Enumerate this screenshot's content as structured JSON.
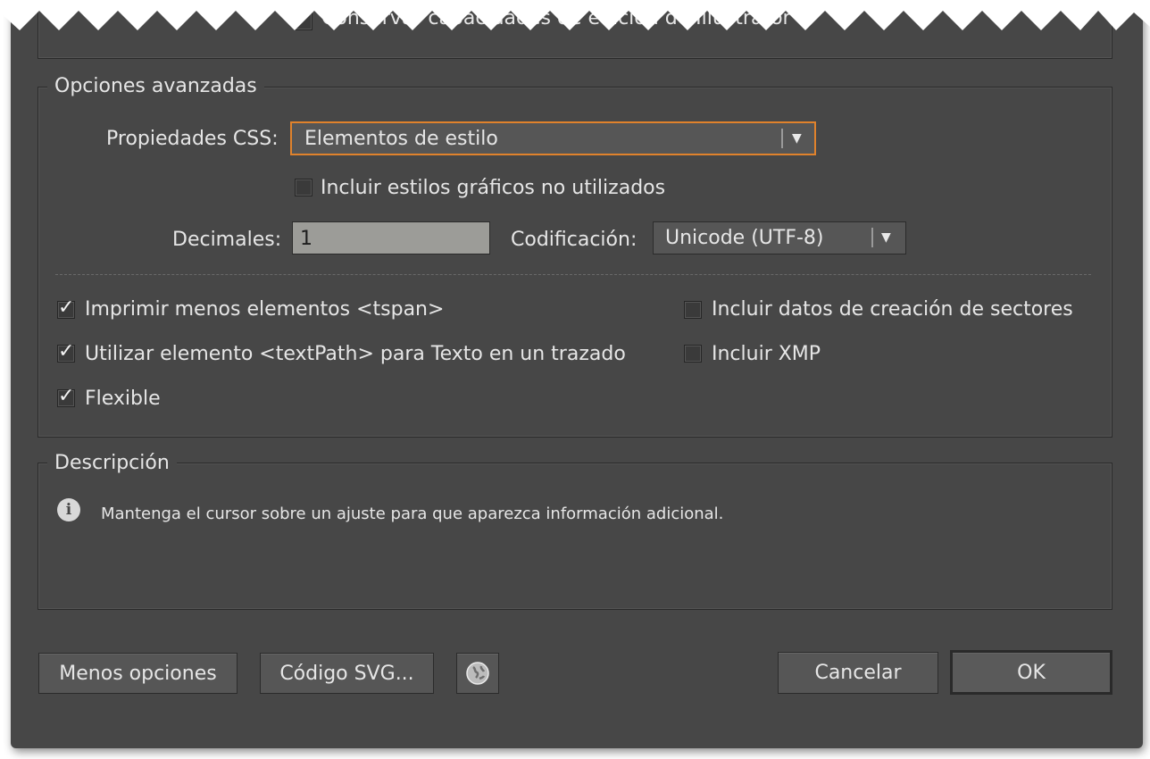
{
  "top_partial_option": "Conservar capacidades de edición de Illustrator",
  "advanced": {
    "legend": "Opciones avanzadas",
    "css_properties_label": "Propiedades CSS:",
    "css_properties_value": "Elementos de estilo",
    "include_unused_styles_label": "Incluir estilos gráficos no utilizados",
    "include_unused_styles_checked": false,
    "decimals_label": "Decimales:",
    "decimals_value": "1",
    "encoding_label": "Codificación:",
    "encoding_value": "Unicode (UTF-8)",
    "options": {
      "fewer_tspan": {
        "label": "Imprimir menos elementos <tspan>",
        "checked": true
      },
      "textpath": {
        "label": "Utilizar elemento <textPath> para Texto en un trazado",
        "checked": true
      },
      "responsive": {
        "label": "Flexible",
        "checked": true
      },
      "slicing_data": {
        "label": "Incluir datos de creación de sectores",
        "checked": false
      },
      "xmp": {
        "label": "Incluir XMP",
        "checked": false
      }
    }
  },
  "description": {
    "legend": "Descripción",
    "icon": "info-icon",
    "text": "Mantenga el cursor sobre un ajuste para que aparezca información adicional."
  },
  "buttons": {
    "less_options": "Menos opciones",
    "svg_code": "Código SVG...",
    "web_icon": "globe-icon",
    "cancel": "Cancelar",
    "ok": "OK"
  },
  "colors": {
    "dialog_bg": "#474747",
    "focus_border": "#e0822c",
    "field_bg": "#9c9c98"
  }
}
